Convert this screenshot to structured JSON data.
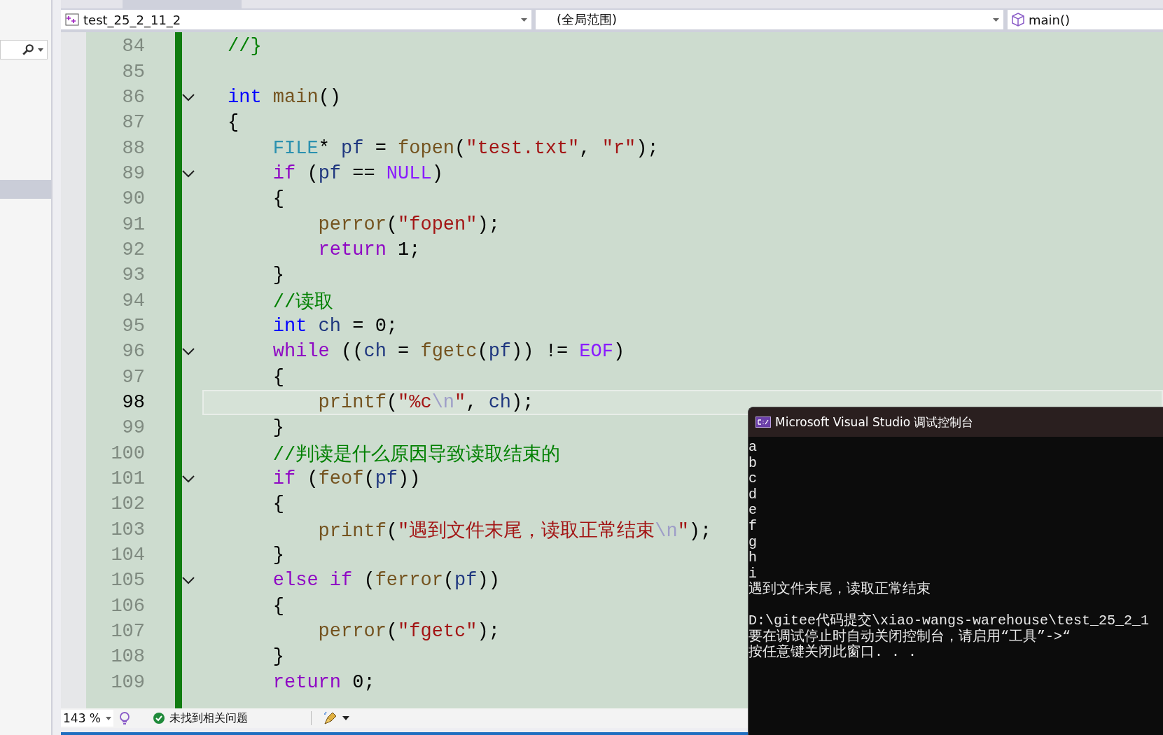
{
  "navigation_bar": {
    "project": "test_25_2_11_2",
    "scope": "(全局范围)",
    "member": "main()"
  },
  "editor": {
    "lines": [
      {
        "number": "84",
        "foldable": false,
        "current": false,
        "tokens": [
          {
            "kind": "comment",
            "text": "//}"
          }
        ]
      },
      {
        "number": "85",
        "foldable": false,
        "current": false
      },
      {
        "number": "86",
        "foldable": true,
        "current": false,
        "tokens": [
          {
            "kind": "keyword",
            "text": "int"
          },
          {
            "kind": "function",
            "text": " main"
          },
          {
            "kind": "plain",
            "text": "()"
          }
        ]
      },
      {
        "number": "87",
        "foldable": false,
        "current": false,
        "tokens": [
          {
            "kind": "plain",
            "text": "{"
          }
        ]
      },
      {
        "number": "88",
        "foldable": false,
        "current": false,
        "tokens": [
          {
            "kind": "type",
            "text": "    FILE"
          },
          {
            "kind": "plain",
            "text": "* "
          },
          {
            "kind": "variable",
            "text": "pf"
          },
          {
            "kind": "plain",
            "text": " = "
          },
          {
            "kind": "function",
            "text": "fopen"
          },
          {
            "kind": "plain",
            "text": "("
          },
          {
            "kind": "string",
            "text": "\"test.txt\""
          },
          {
            "kind": "plain",
            "text": ", "
          },
          {
            "kind": "string",
            "text": "\"r\""
          },
          {
            "kind": "plain",
            "text": ");"
          }
        ]
      },
      {
        "number": "89",
        "foldable": true,
        "current": false,
        "tokens": [
          {
            "kind": "control",
            "text": "    if"
          },
          {
            "kind": "plain",
            "text": " ("
          },
          {
            "kind": "variable",
            "text": "pf"
          },
          {
            "kind": "plain",
            "text": " == "
          },
          {
            "kind": "macro",
            "text": "NULL"
          },
          {
            "kind": "plain",
            "text": ")"
          }
        ]
      },
      {
        "number": "90",
        "foldable": false,
        "current": false,
        "tokens": [
          {
            "kind": "plain",
            "text": "    {"
          }
        ]
      },
      {
        "number": "91",
        "foldable": false,
        "current": false,
        "tokens": [
          {
            "kind": "function",
            "text": "        perror"
          },
          {
            "kind": "plain",
            "text": "("
          },
          {
            "kind": "string",
            "text": "\"fopen\""
          },
          {
            "kind": "plain",
            "text": ");"
          }
        ]
      },
      {
        "number": "92",
        "foldable": false,
        "current": false,
        "tokens": [
          {
            "kind": "control",
            "text": "        return"
          },
          {
            "kind": "plain",
            "text": " 1;"
          }
        ]
      },
      {
        "number": "93",
        "foldable": false,
        "current": false,
        "tokens": [
          {
            "kind": "plain",
            "text": "    }"
          }
        ]
      },
      {
        "number": "94",
        "foldable": false,
        "current": false,
        "tokens": [
          {
            "kind": "comment",
            "text": "    //读取"
          }
        ]
      },
      {
        "number": "95",
        "foldable": false,
        "current": false,
        "tokens": [
          {
            "kind": "keyword",
            "text": "    int"
          },
          {
            "kind": "variable",
            "text": " ch"
          },
          {
            "kind": "plain",
            "text": " = 0;"
          }
        ]
      },
      {
        "number": "96",
        "foldable": true,
        "current": false,
        "tokens": [
          {
            "kind": "control",
            "text": "    while"
          },
          {
            "kind": "plain",
            "text": " (("
          },
          {
            "kind": "variable",
            "text": "ch"
          },
          {
            "kind": "plain",
            "text": " = "
          },
          {
            "kind": "function",
            "text": "fgetc"
          },
          {
            "kind": "plain",
            "text": "("
          },
          {
            "kind": "variable",
            "text": "pf"
          },
          {
            "kind": "plain",
            "text": ")) != "
          },
          {
            "kind": "macro",
            "text": "EOF"
          },
          {
            "kind": "plain",
            "text": ")"
          }
        ]
      },
      {
        "number": "97",
        "foldable": false,
        "current": false,
        "tokens": [
          {
            "kind": "plain",
            "text": "    {"
          }
        ]
      },
      {
        "number": "98",
        "foldable": false,
        "current": true,
        "tokens": [
          {
            "kind": "function",
            "text": "        printf"
          },
          {
            "kind": "plain",
            "text": "("
          },
          {
            "kind": "string",
            "text": "\"%c"
          },
          {
            "kind": "escape",
            "text": "\\n"
          },
          {
            "kind": "string",
            "text": "\""
          },
          {
            "kind": "plain",
            "text": ", "
          },
          {
            "kind": "variable",
            "text": "ch"
          },
          {
            "kind": "plain",
            "text": ");"
          }
        ]
      },
      {
        "number": "99",
        "foldable": false,
        "current": false,
        "tokens": [
          {
            "kind": "plain",
            "text": "    }"
          }
        ]
      },
      {
        "number": "100",
        "foldable": false,
        "current": false,
        "tokens": [
          {
            "kind": "comment",
            "text": "    //判读是什么原因导致读取结束的"
          }
        ]
      },
      {
        "number": "101",
        "foldable": true,
        "current": false,
        "tokens": [
          {
            "kind": "control",
            "text": "    if"
          },
          {
            "kind": "plain",
            "text": " ("
          },
          {
            "kind": "function",
            "text": "feof"
          },
          {
            "kind": "plain",
            "text": "("
          },
          {
            "kind": "variable",
            "text": "pf"
          },
          {
            "kind": "plain",
            "text": "))"
          }
        ]
      },
      {
        "number": "102",
        "foldable": false,
        "current": false,
        "tokens": [
          {
            "kind": "plain",
            "text": "    {"
          }
        ]
      },
      {
        "number": "103",
        "foldable": false,
        "current": false,
        "tokens": [
          {
            "kind": "function",
            "text": "        printf"
          },
          {
            "kind": "plain",
            "text": "("
          },
          {
            "kind": "string",
            "text": "\"遇到文件末尾，读取正常结束"
          },
          {
            "kind": "escape",
            "text": "\\n"
          },
          {
            "kind": "string",
            "text": "\""
          },
          {
            "kind": "plain",
            "text": ");"
          }
        ]
      },
      {
        "number": "104",
        "foldable": false,
        "current": false,
        "tokens": [
          {
            "kind": "plain",
            "text": "    }"
          }
        ]
      },
      {
        "number": "105",
        "foldable": true,
        "current": false,
        "tokens": [
          {
            "kind": "control",
            "text": "    else if"
          },
          {
            "kind": "plain",
            "text": " ("
          },
          {
            "kind": "function",
            "text": "ferror"
          },
          {
            "kind": "plain",
            "text": "("
          },
          {
            "kind": "variable",
            "text": "pf"
          },
          {
            "kind": "plain",
            "text": "))"
          }
        ]
      },
      {
        "number": "106",
        "foldable": false,
        "current": false,
        "tokens": [
          {
            "kind": "plain",
            "text": "    {"
          }
        ]
      },
      {
        "number": "107",
        "foldable": false,
        "current": false,
        "tokens": [
          {
            "kind": "function",
            "text": "        perror"
          },
          {
            "kind": "plain",
            "text": "("
          },
          {
            "kind": "string",
            "text": "\"fgetc\""
          },
          {
            "kind": "plain",
            "text": ");"
          }
        ]
      },
      {
        "number": "108",
        "foldable": false,
        "current": false,
        "tokens": [
          {
            "kind": "plain",
            "text": "    }"
          }
        ]
      },
      {
        "number": "109",
        "foldable": false,
        "current": false,
        "tokens": [
          {
            "kind": "control",
            "text": "    return"
          },
          {
            "kind": "plain",
            "text": " 0;"
          }
        ]
      }
    ]
  },
  "status_bar": {
    "zoom": "143 %",
    "issues": "未找到相关问题"
  },
  "console": {
    "title": "Microsoft Visual Studio 调试控制台",
    "output": [
      "a",
      "b",
      "c",
      "d",
      "e",
      "f",
      "g",
      "h",
      "i",
      "遇到文件末尾，读取正常结束"
    ],
    "messages": [
      "D:\\gitee代码提交\\xiao-wangs-warehouse\\test_25_2_1",
      "要在调试停止时自动关闭控制台，请启用“工具”->“",
      "按任意键关闭此窗口. . ."
    ]
  }
}
